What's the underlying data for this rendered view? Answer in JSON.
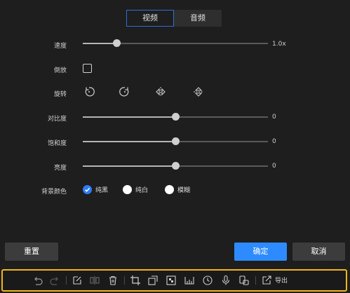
{
  "tabs": [
    {
      "label": "视频",
      "active": true
    },
    {
      "label": "音频",
      "active": false
    }
  ],
  "speed": {
    "label": "速度",
    "value": "1.0x",
    "level": 0.18
  },
  "reverse": {
    "label": "倒放",
    "checked": false
  },
  "rotate": {
    "label": "旋转",
    "icons": [
      "rotate-left-icon",
      "rotate-right-icon",
      "flip-horizontal-icon",
      "flip-vertical-icon"
    ]
  },
  "contrast": {
    "label": "对比度",
    "value": "0",
    "level": 0.5
  },
  "saturation": {
    "label": "饱和度",
    "value": "0",
    "level": 0.5
  },
  "brightness": {
    "label": "亮度",
    "value": "0",
    "level": 0.5
  },
  "background": {
    "label": "背景颜色",
    "options": [
      {
        "label": "纯黑",
        "checked": true
      },
      {
        "label": "纯白",
        "checked": false
      },
      {
        "label": "模糊",
        "checked": false
      }
    ]
  },
  "buttons": {
    "reset": "重置",
    "confirm": "确定",
    "cancel": "取消"
  },
  "toolbar": {
    "export_label": "导出",
    "icons": [
      "undo-icon",
      "redo-icon",
      "edit-icon",
      "split-icon",
      "delete-icon",
      "crop-icon",
      "resize-icon",
      "mosaic-icon",
      "ruler-icon",
      "clock-icon",
      "microphone-icon",
      "sticker-icon",
      "export-icon"
    ]
  },
  "colors": {
    "accent": "#2e8bff",
    "toolbar_border": "#f2b618",
    "background": "#1e1e1e"
  }
}
